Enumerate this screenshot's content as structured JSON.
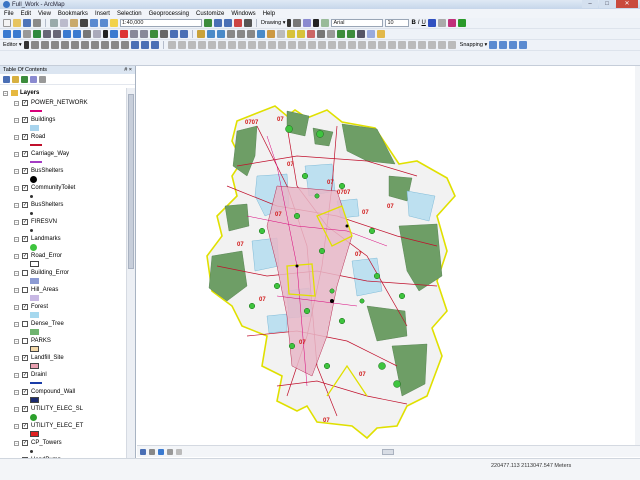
{
  "window": {
    "title": "Full_Work - ArcMap",
    "minimize": "–",
    "maximize": "□",
    "close": "✕"
  },
  "menu": [
    "File",
    "Edit",
    "View",
    "Bookmarks",
    "Insert",
    "Selection",
    "Geoprocessing",
    "Customize",
    "Windows",
    "Help"
  ],
  "toolbar": {
    "scale": "1:40,000",
    "drawing_label": "Drawing ▾",
    "font": "Arial",
    "font_size": "10",
    "bold": "B",
    "italic": "I",
    "underline": "U",
    "editor_label": "Editor ▾",
    "snapping_label": "Snapping ▾"
  },
  "toc": {
    "title": "Table Of Contents",
    "pin": "# ×",
    "layers_group": "Layers",
    "layers": [
      {
        "name": "POWER_NETWORK",
        "checked": true,
        "sym": "line",
        "color": "#d9007a"
      },
      {
        "name": "Buildings",
        "checked": true,
        "sym": "rect",
        "color": "#a8d4ee"
      },
      {
        "name": "Road",
        "checked": true,
        "sym": "line",
        "color": "#c0102c"
      },
      {
        "name": "Carriage_Way",
        "checked": true,
        "sym": "line",
        "color": "#a43cc4"
      },
      {
        "name": "BusShelters",
        "checked": true,
        "sym": "dot",
        "color": "#000000"
      },
      {
        "name": "CommunityToilet",
        "checked": true,
        "sym": "small",
        "color": "#333333"
      },
      {
        "name": "BusShelters",
        "checked": true,
        "sym": "small",
        "color": "#333333"
      },
      {
        "name": "FIRESVN",
        "checked": true,
        "sym": "small",
        "color": "#333333"
      },
      {
        "name": "Landmarks",
        "checked": true,
        "sym": "dot",
        "color": "#3ec43e"
      },
      {
        "name": "Road_Error",
        "checked": true,
        "sym": "box",
        "color": "#ffffff"
      },
      {
        "name": "Building_Error",
        "checked": false,
        "sym": "rect",
        "color": "#8c9bd4"
      },
      {
        "name": "Hill_Areas",
        "checked": false,
        "sym": "rect",
        "color": "#c8b8e4"
      },
      {
        "name": "Forest",
        "checked": true,
        "sym": "rect",
        "color": "#a6d8ee"
      },
      {
        "name": "Dense_Tree",
        "checked": false,
        "sym": "rect",
        "color": "#6fb46f"
      },
      {
        "name": "PARKS",
        "checked": false,
        "sym": "box",
        "color": "#f3d8a8"
      },
      {
        "name": "Landfill_Site",
        "checked": true,
        "sym": "box",
        "color": "#e8a0b0"
      },
      {
        "name": "Drainl",
        "checked": true,
        "sym": "line",
        "color": "#1a3ca8"
      },
      {
        "name": "Compound_Wall",
        "checked": true,
        "sym": "box",
        "color": "#1a2a70"
      },
      {
        "name": "UTILITY_ELEC_SL",
        "checked": true,
        "sym": "dot",
        "color": "#2ca02c"
      },
      {
        "name": "UTILITY_ELEC_ET",
        "checked": true,
        "sym": "box",
        "color": "#e02020"
      },
      {
        "name": "CP_Towers",
        "checked": true,
        "sym": "small",
        "color": "#333333"
      },
      {
        "name": "HandPump",
        "checked": true,
        "sym": "small",
        "color": "#333333"
      }
    ]
  },
  "map": {
    "labels": [
      "0707",
      "07",
      "07",
      "07",
      "07",
      "07",
      "07",
      "0707",
      "07",
      "07",
      "07",
      "07",
      "07",
      "07"
    ]
  },
  "status": {
    "coords": "220477.113  2113047.547 Meters"
  }
}
